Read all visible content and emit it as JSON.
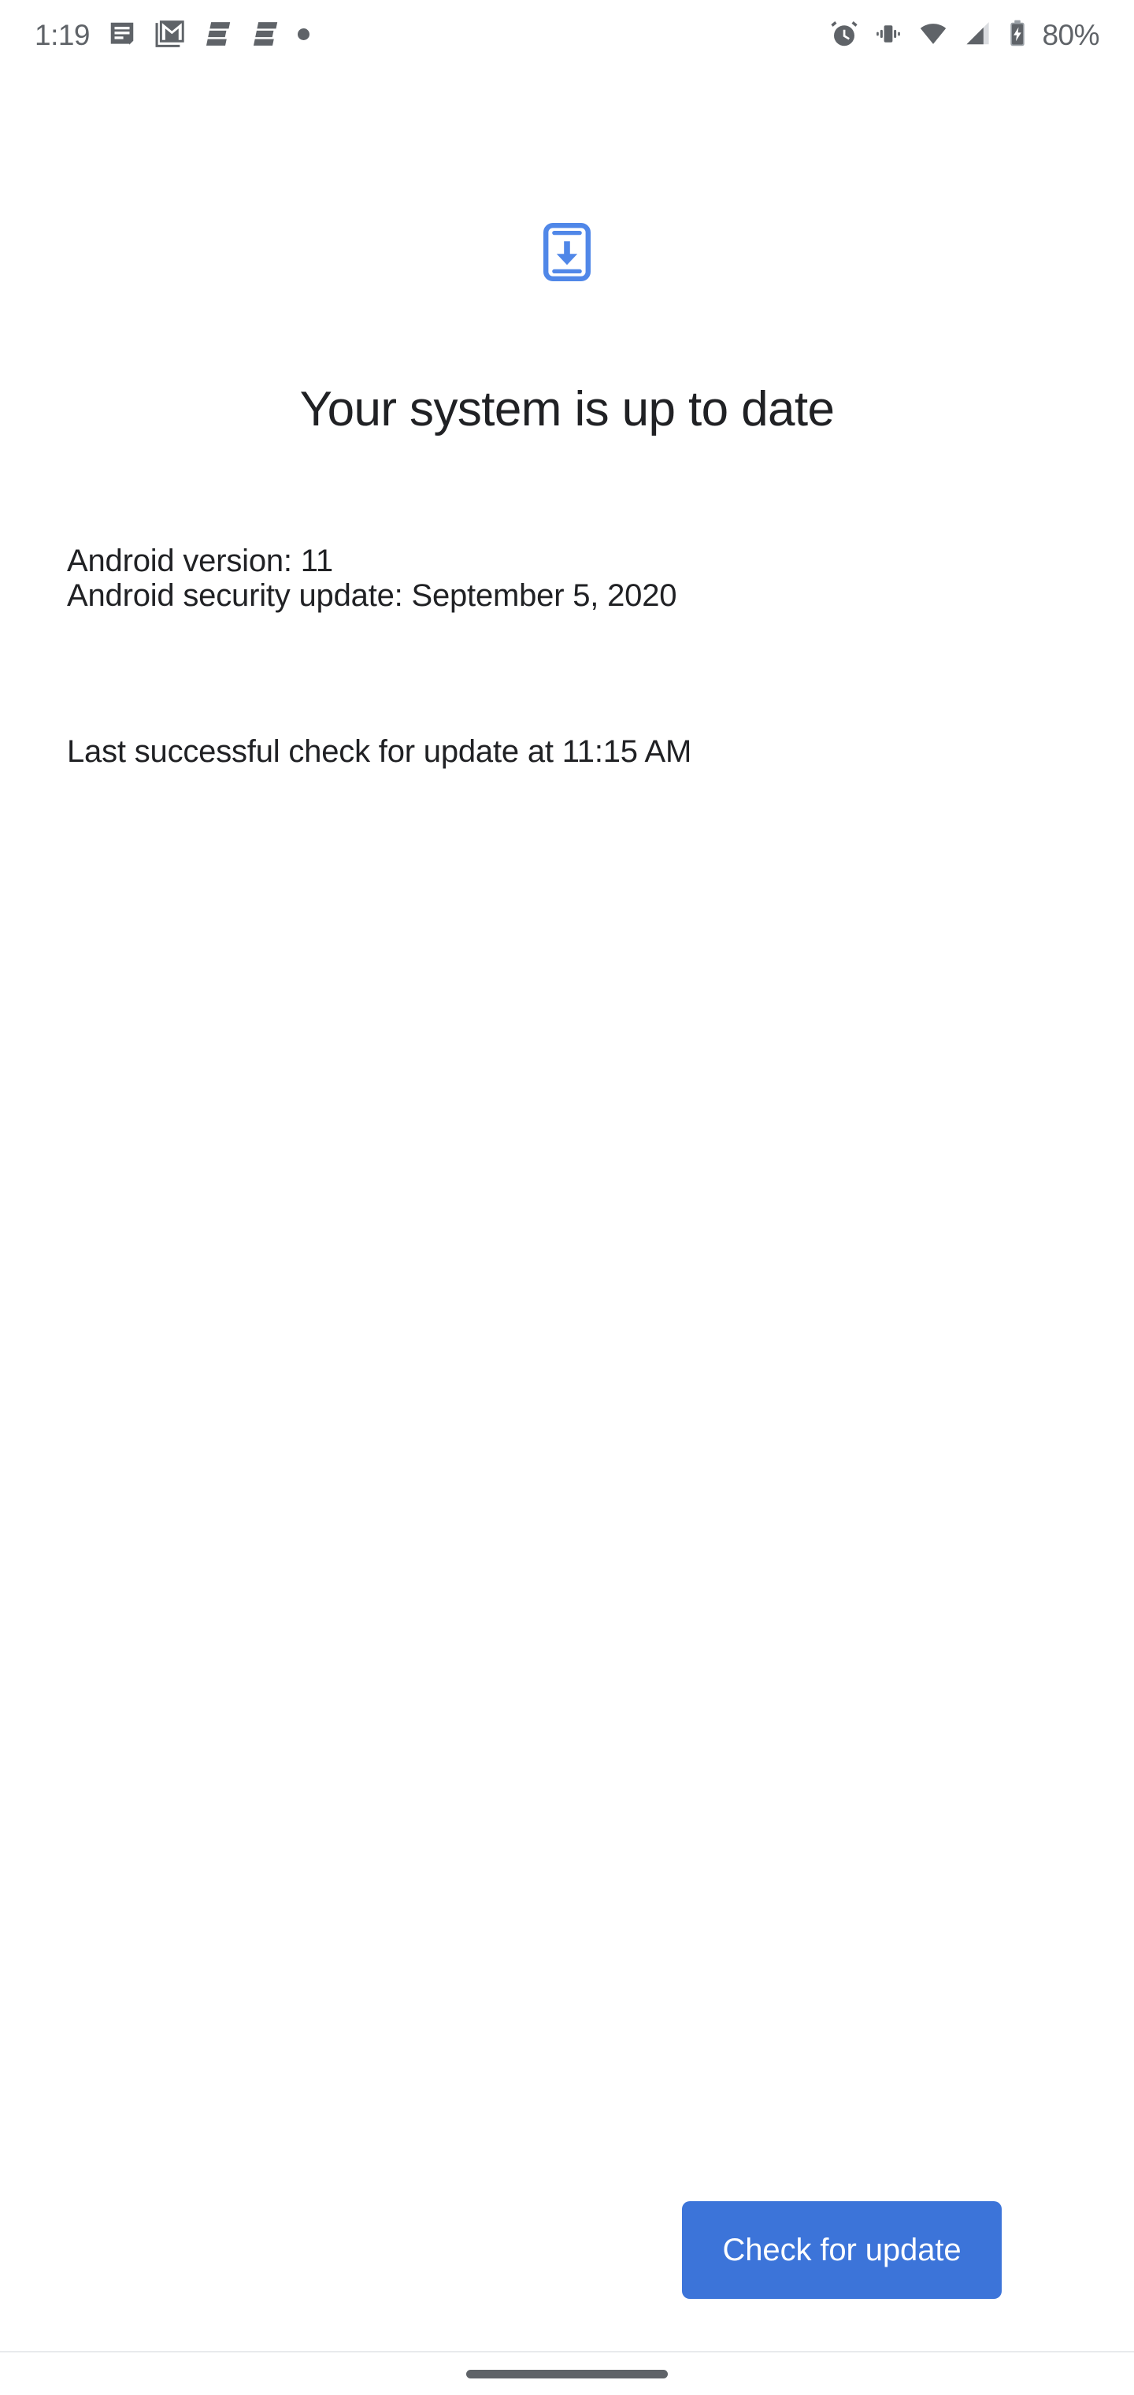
{
  "status_bar": {
    "clock": "1:19",
    "battery_percent": "80%",
    "left_icons": [
      {
        "name": "messages-icon",
        "label": "Messages notification"
      },
      {
        "name": "gmail-icon",
        "label": "Gmail notification"
      },
      {
        "name": "app-notification-icon-1",
        "label": "App notification"
      },
      {
        "name": "app-notification-icon-2",
        "label": "App notification"
      },
      {
        "name": "more-notifications-dot-icon",
        "label": "More notifications"
      }
    ],
    "right_icons": [
      {
        "name": "alarm-icon",
        "label": "Alarm set"
      },
      {
        "name": "vibrate-icon",
        "label": "Ringer vibrate"
      },
      {
        "name": "wifi-icon",
        "label": "Wi-Fi connected"
      },
      {
        "name": "cellular-signal-icon",
        "label": "Cellular signal"
      },
      {
        "name": "battery-charging-icon",
        "label": "Battery charging"
      }
    ]
  },
  "main": {
    "hero_icon_name": "system-update-icon",
    "title": "Your system is up to date",
    "info_lines": [
      "Android version: 11",
      "Android security update: September 5, 2020"
    ],
    "last_check": "Last successful check for update at 11:15 AM"
  },
  "actions": {
    "check_for_update_label": "Check for update"
  },
  "nav_bar": {
    "gesture_handle_name": "gesture-navigation-handle"
  },
  "colors": {
    "accent_blue": "#3c74d9",
    "icon_blue": "#5087e8",
    "text_primary": "#202124",
    "status_icon_gray": "#5f6368",
    "divider": "#e8eaed"
  }
}
